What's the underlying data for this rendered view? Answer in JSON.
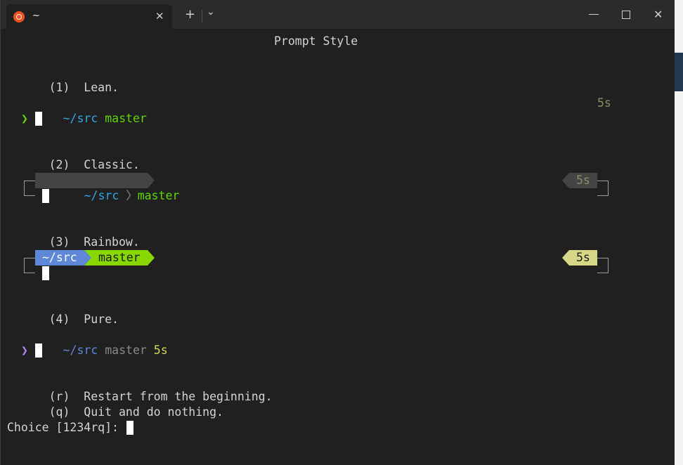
{
  "tab": {
    "title": "~",
    "icon": "ubuntu-icon"
  },
  "titlebar": {
    "new_tab": "+",
    "dropdown": "⌄",
    "minimize": "—",
    "maximize": "☐",
    "close": "✕"
  },
  "heading": "Prompt Style",
  "options": [
    {
      "key": "(1)",
      "label": "Lean."
    },
    {
      "key": "(2)",
      "label": "Classic."
    },
    {
      "key": "(3)",
      "label": "Rainbow."
    },
    {
      "key": "(4)",
      "label": "Pure."
    }
  ],
  "sample": {
    "dir": "~/src",
    "branch": "master",
    "duration": "5s",
    "arrow": "❯"
  },
  "extra": [
    {
      "key": "(r)",
      "label": "Restart from the beginning."
    },
    {
      "key": "(q)",
      "label": "Quit and do nothing."
    }
  ],
  "choice_prompt": "Choice [1234rq]: ",
  "colors": {
    "dir": "#2ea7e6",
    "branch": "#5fd700",
    "classic_bg": "#444444",
    "rainbow_dir_bg": "#5f87d7",
    "rainbow_branch_bg": "#87d700",
    "rainbow_time_bg": "#d7d787",
    "pure_arrow": "#af87ff",
    "lean_arrow": "#5fd700"
  }
}
